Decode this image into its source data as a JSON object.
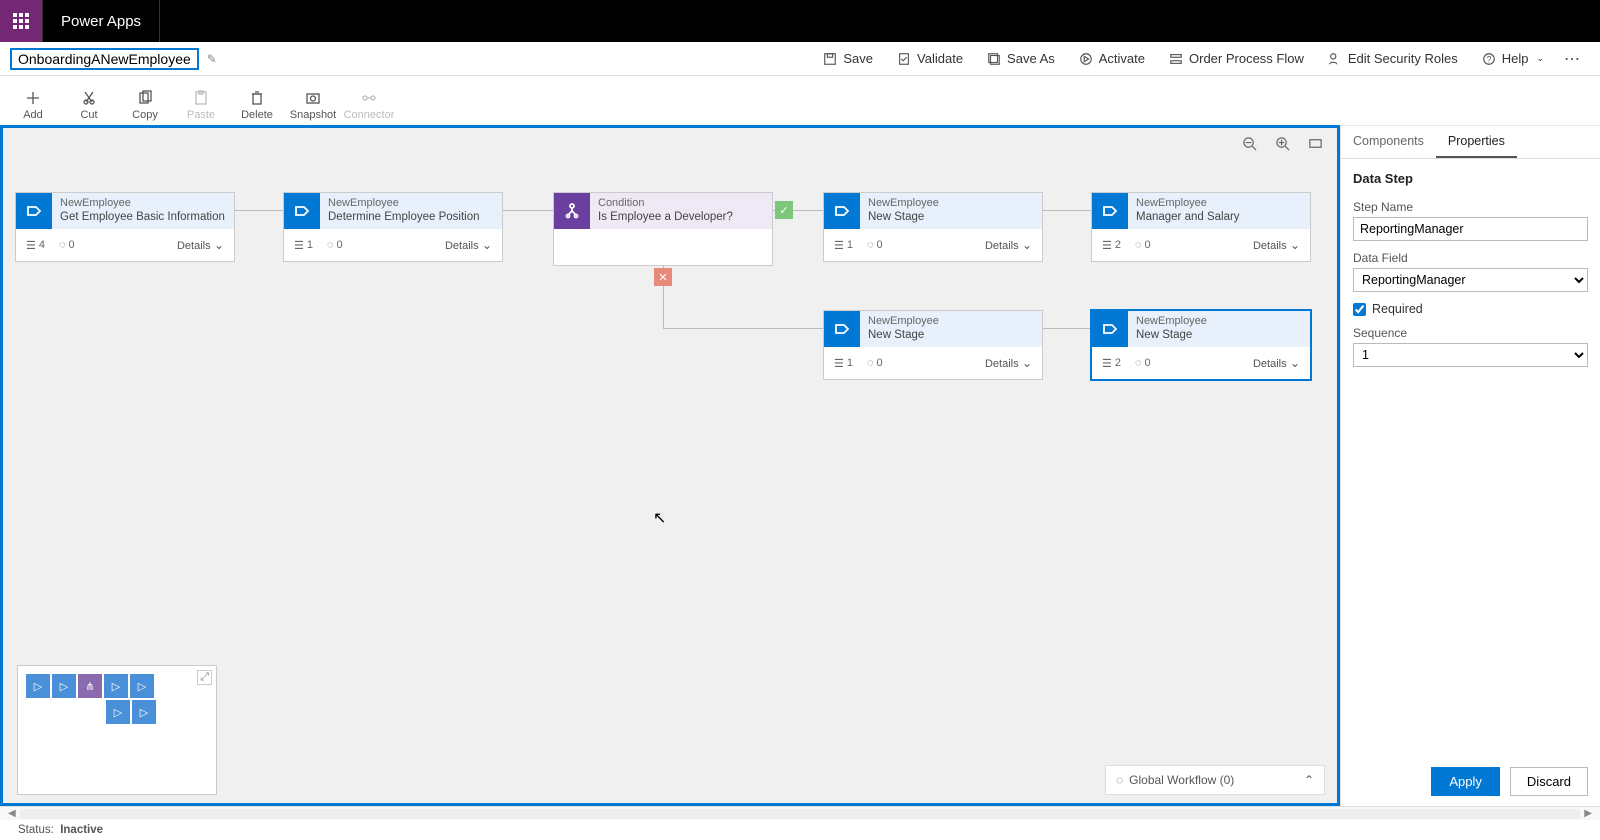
{
  "topbar": {
    "app_name": "Power Apps"
  },
  "title": "OnboardingANewEmployee",
  "cmdbar": {
    "save": "Save",
    "validate": "Validate",
    "save_as": "Save As",
    "activate": "Activate",
    "order": "Order Process Flow",
    "edit_roles": "Edit Security Roles",
    "help": "Help"
  },
  "toolbar": {
    "add": "Add",
    "cut": "Cut",
    "copy": "Copy",
    "paste": "Paste",
    "delete": "Delete",
    "snapshot": "Snapshot",
    "connector": "Connector"
  },
  "nodes": {
    "n1": {
      "entity": "NewEmployee",
      "name": "Get Employee Basic Information",
      "steps": "4",
      "wf": "0",
      "details": "Details"
    },
    "n2": {
      "entity": "NewEmployee",
      "name": "Determine Employee Position",
      "steps": "1",
      "wf": "0",
      "details": "Details"
    },
    "n3": {
      "entity": "Condition",
      "name": "Is Employee a Developer?"
    },
    "n4": {
      "entity": "NewEmployee",
      "name": "New Stage",
      "steps": "1",
      "wf": "0",
      "details": "Details"
    },
    "n5": {
      "entity": "NewEmployee",
      "name": "Manager and Salary",
      "steps": "2",
      "wf": "0",
      "details": "Details"
    },
    "n6": {
      "entity": "NewEmployee",
      "name": "New Stage",
      "steps": "1",
      "wf": "0",
      "details": "Details"
    },
    "n7": {
      "entity": "NewEmployee",
      "name": "New Stage",
      "steps": "2",
      "wf": "0",
      "details": "Details"
    }
  },
  "global_wf": "Global Workflow (0)",
  "rpanel": {
    "tab_components": "Components",
    "tab_properties": "Properties",
    "heading": "Data Step",
    "step_name_label": "Step Name",
    "step_name_value": "ReportingManager",
    "data_field_label": "Data Field",
    "data_field_value": "ReportingManager",
    "required_label": "Required",
    "sequence_label": "Sequence",
    "sequence_value": "1",
    "apply": "Apply",
    "discard": "Discard"
  },
  "status": {
    "label": "Status:",
    "value": "Inactive"
  }
}
